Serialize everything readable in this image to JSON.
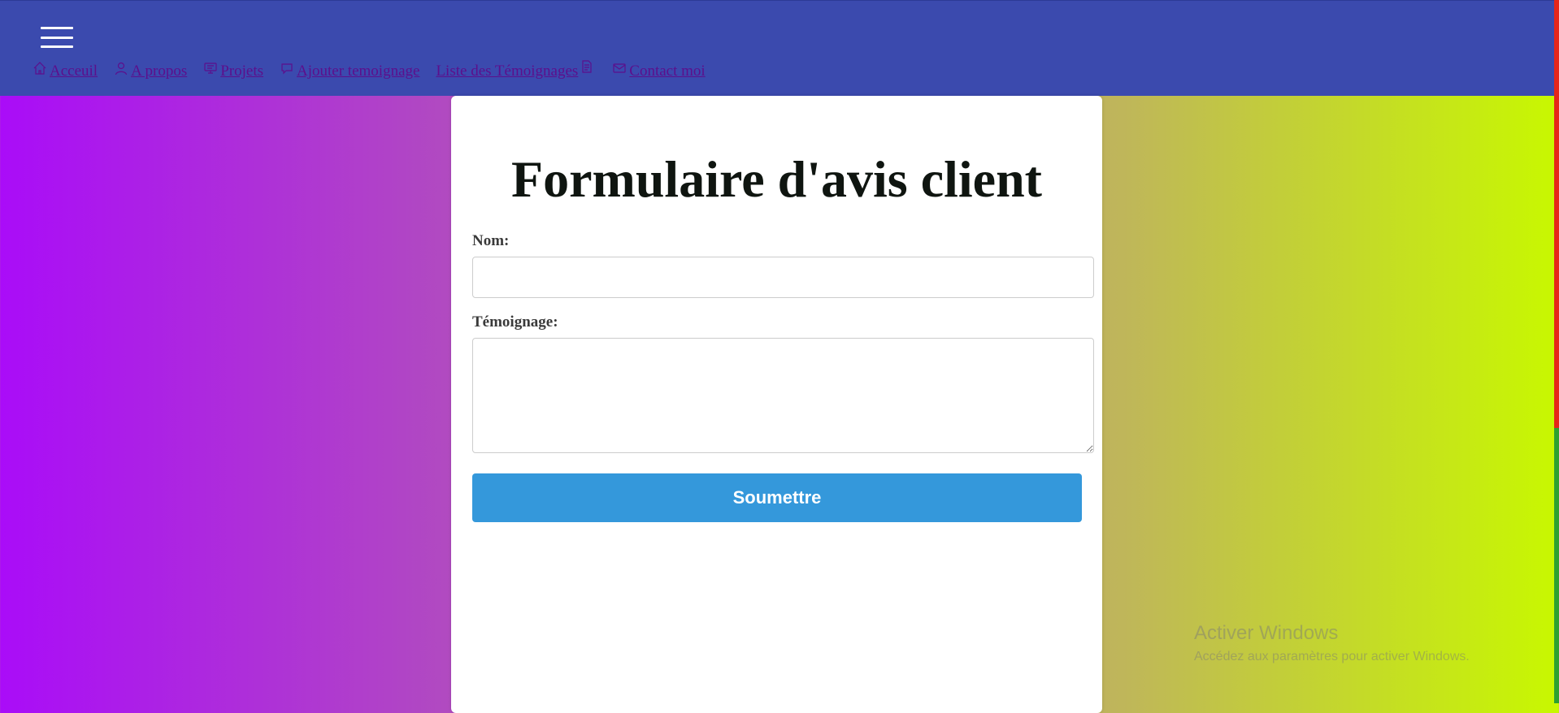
{
  "header": {
    "menu_icon": "hamburger-icon",
    "nav": [
      {
        "label": "Acceuil",
        "icon": "home-icon"
      },
      {
        "label": "A propos",
        "icon": "user-icon"
      },
      {
        "label": "Projets",
        "icon": "monitor-icon"
      },
      {
        "label": "Ajouter temoignage",
        "icon": "chat-icon"
      },
      {
        "label": "Liste des Témoignages",
        "icon": "document-icon"
      },
      {
        "label": "Contact moi",
        "icon": "mail-icon"
      }
    ]
  },
  "form": {
    "title": "Formulaire d'avis client",
    "name_label": "Nom:",
    "name_value": "",
    "testimony_label": "Témoignage:",
    "testimony_value": "",
    "submit_label": "Soumettre"
  },
  "watermark": {
    "line1": "Activer Windows",
    "line2": "Accédez aux paramètres pour activer Windows."
  },
  "colors": {
    "header_bg": "#3b4aae",
    "link": "#5c0f8c",
    "button": "#3498db",
    "gradient_start": "#aa0cf8",
    "gradient_end": "#c8f800"
  }
}
